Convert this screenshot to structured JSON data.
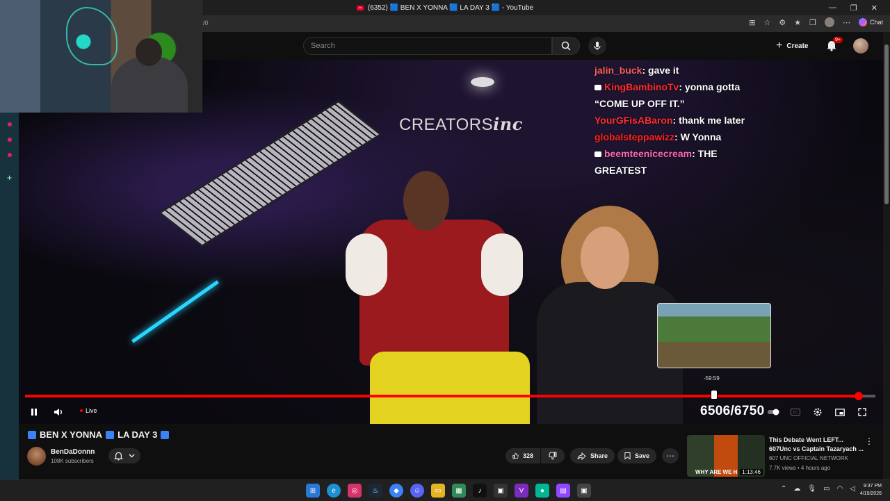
{
  "browser": {
    "tab_title": "(6352) 🟦 BEN X YONNA 🟦 LA DAY 3 🟦 - YouTube",
    "url_fragment": "/0",
    "window_controls": [
      "—",
      "❐",
      "✕"
    ],
    "chat_button": "Chat"
  },
  "youtube": {
    "search_placeholder": "Search",
    "create_label": "Create",
    "notifications_badge": "9+"
  },
  "video": {
    "brand_logo_text": "CREATORS",
    "brand_logo_italic": "inc",
    "chat": [
      {
        "user": "jalin_buck",
        "msg": "gave it",
        "color": "#ff5f5f",
        "badge": false
      },
      {
        "user": "KingBambinoTv",
        "msg": "yonna gotta",
        "color": "#ff2a2a",
        "badge": true
      },
      {
        "user": "",
        "msg": "“COME UP OFF IT.”",
        "color": "#ffffff",
        "badge": false
      },
      {
        "user": "YourGFisABaron",
        "msg": "thank me later",
        "color": "#ff3030",
        "badge": false
      },
      {
        "user": "globalsteppawizz",
        "msg": "W Yonna",
        "color": "#ff2020",
        "badge": false
      },
      {
        "user": "beemteenicecream",
        "msg": "THE",
        "color": "#ff69b4",
        "badge": true
      },
      {
        "user": "",
        "msg": "GREATEST",
        "color": "#ffffff",
        "badge": false
      }
    ],
    "preview_time": "-59:59",
    "live_label": "Live",
    "view_counter": "6506/6750",
    "progress": 0.98
  },
  "below": {
    "title_parts": [
      "BEN X YONNA",
      "LA DAY 3"
    ],
    "channel_name": "BenDaDonnn",
    "subscribers": "108K subscribers",
    "like_count": "328",
    "share_label": "Share",
    "save_label": "Save"
  },
  "suggestion": {
    "title": "This Debate Went LEFT... 607Unc vs Captain Tazaryach ...",
    "channel": "607 UNC OFFICIAL NETWORK",
    "meta": "7.7K views • 4 hours ago",
    "duration": "1:13:46",
    "thumb_caption": "WHY ARE WE H"
  },
  "taskbar": {
    "time": "9:37 PM",
    "date": "4/19/2026"
  }
}
